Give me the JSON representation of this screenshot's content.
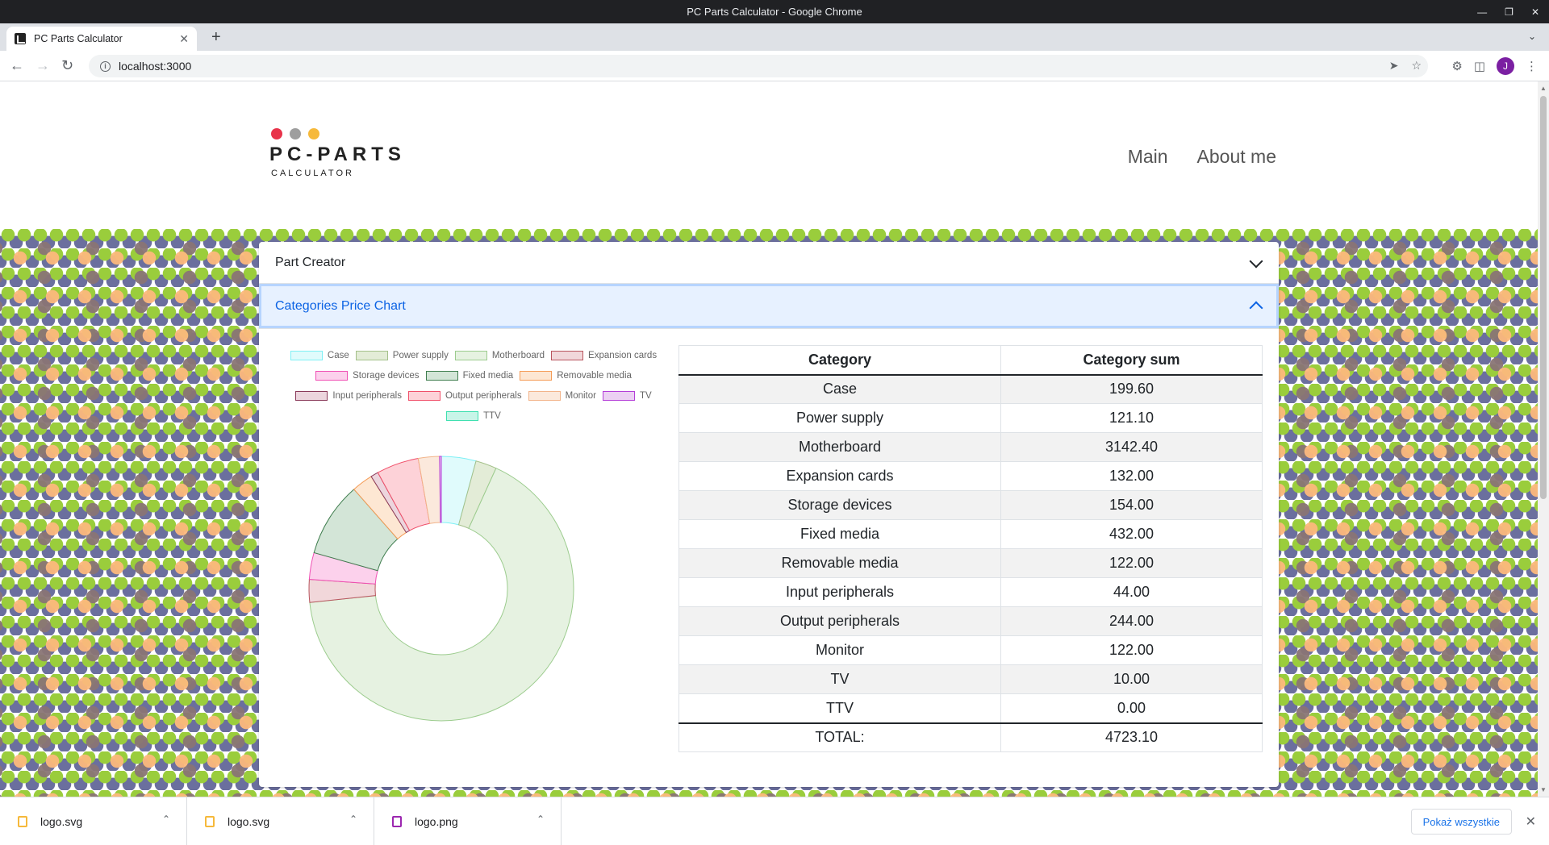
{
  "window": {
    "title": "PC Parts Calculator - Google Chrome",
    "tab_title": "PC Parts Calculator",
    "url": "localhost:3000",
    "avatar_letter": "J"
  },
  "header": {
    "brand": "PC-PARTS",
    "brand_sub": "CALCULATOR",
    "dot_colors": [
      "#e8334a",
      "#9e9e9e",
      "#f6b93b"
    ],
    "nav": [
      "Main",
      "About me"
    ]
  },
  "accordion": {
    "part_creator_label": "Part Creator",
    "chart_label": "Categories Price Chart"
  },
  "table": {
    "col_category": "Category",
    "col_sum": "Category sum",
    "rows": [
      {
        "category": "Case",
        "sum": "199.60"
      },
      {
        "category": "Power supply",
        "sum": "121.10"
      },
      {
        "category": "Motherboard",
        "sum": "3142.40"
      },
      {
        "category": "Expansion cards",
        "sum": "132.00"
      },
      {
        "category": "Storage devices",
        "sum": "154.00"
      },
      {
        "category": "Fixed media",
        "sum": "432.00"
      },
      {
        "category": "Removable media",
        "sum": "122.00"
      },
      {
        "category": "Input peripherals",
        "sum": "44.00"
      },
      {
        "category": "Output peripherals",
        "sum": "244.00"
      },
      {
        "category": "Monitor",
        "sum": "122.00"
      },
      {
        "category": "TV",
        "sum": "10.00"
      },
      {
        "category": "TTV",
        "sum": "0.00"
      }
    ],
    "total_label": "TOTAL:",
    "total_value": "4723.10"
  },
  "chart_data": {
    "type": "pie",
    "categories": [
      "Case",
      "Power supply",
      "Motherboard",
      "Expansion cards",
      "Storage devices",
      "Fixed media",
      "Removable media",
      "Input peripherals",
      "Output peripherals",
      "Monitor",
      "TV",
      "TTV"
    ],
    "values": [
      199.6,
      121.1,
      3142.4,
      132.0,
      154.0,
      432.0,
      122.0,
      44.0,
      244.0,
      122.0,
      10.0,
      0.0
    ],
    "fills": [
      "#e0fbfc",
      "#e3ecd7",
      "#e6f2e1",
      "#f1d7da",
      "#fcd1ec",
      "#d3e5d7",
      "#fde7d3",
      "#ecd5dd",
      "#fdd2d8",
      "#fbe9dc",
      "#ecd0f3",
      "#c8f5e8"
    ],
    "strokes": [
      "#7ff0f5",
      "#a4c08a",
      "#9ccc8e",
      "#b8555e",
      "#f04fb4",
      "#3f7d4e",
      "#f59b55",
      "#8a3a5a",
      "#f0506a",
      "#f2b48a",
      "#b43ed8",
      "#3fe0b0"
    ],
    "legend_position": "top",
    "doughnut": true
  },
  "downloads": {
    "items": [
      "logo.svg",
      "logo.svg",
      "logo.png"
    ],
    "show_all": "Pokaż wszystkie"
  }
}
